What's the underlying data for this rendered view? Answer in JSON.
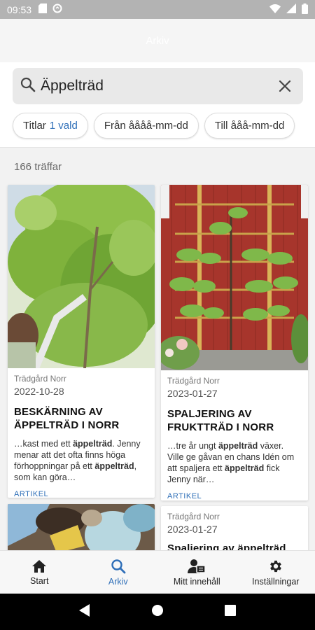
{
  "status_bar": {
    "time": "09:53"
  },
  "header": {
    "title": "Arkiv"
  },
  "search": {
    "query": "Äppelträd"
  },
  "filters": {
    "titles_label": "Titlar",
    "titles_value": "1 vald",
    "from_label": "Från åååå-mm-dd",
    "to_label": "Till ååå-mm-dd"
  },
  "results": {
    "count_label": "166 träffar",
    "cards": [
      {
        "source": "Trädgård Norr",
        "date": "2022-10-28",
        "title": "BESKÄRNING AV ÄPPELTRÄD I NORR",
        "excerpt_parts": [
          "…kast med ett ",
          "äppelträd",
          ". Jenny menar att det ofta finns höga förhoppningar på ett ",
          "äppelträd",
          ", som kan göra…"
        ],
        "tag": "ARTIKEL"
      },
      {
        "source": "Trädgård Norr",
        "date": "2023-01-27",
        "title": "SPALJERING AV FRUKTTRÄD I NORR",
        "excerpt_parts": [
          "…tre år ungt ",
          "äppelträd",
          " växer. Ville ge gåvan en chans Idén om att spaljera ett ",
          "äppelträd",
          " fick Jenny när…"
        ],
        "tag": "ARTIKEL"
      },
      {
        "source": "Trädgård Norr",
        "date": "2023-01-27",
        "title": "Spaljering av äppelträd"
      }
    ]
  },
  "bottom_nav": [
    {
      "label": "Start",
      "icon": "home-icon"
    },
    {
      "label": "Arkiv",
      "icon": "search-icon"
    },
    {
      "label": "Mitt innehåll",
      "icon": "person-card-icon"
    },
    {
      "label": "Inställningar",
      "icon": "gear-icon"
    }
  ],
  "colors": {
    "accent": "#2f6fb8"
  }
}
